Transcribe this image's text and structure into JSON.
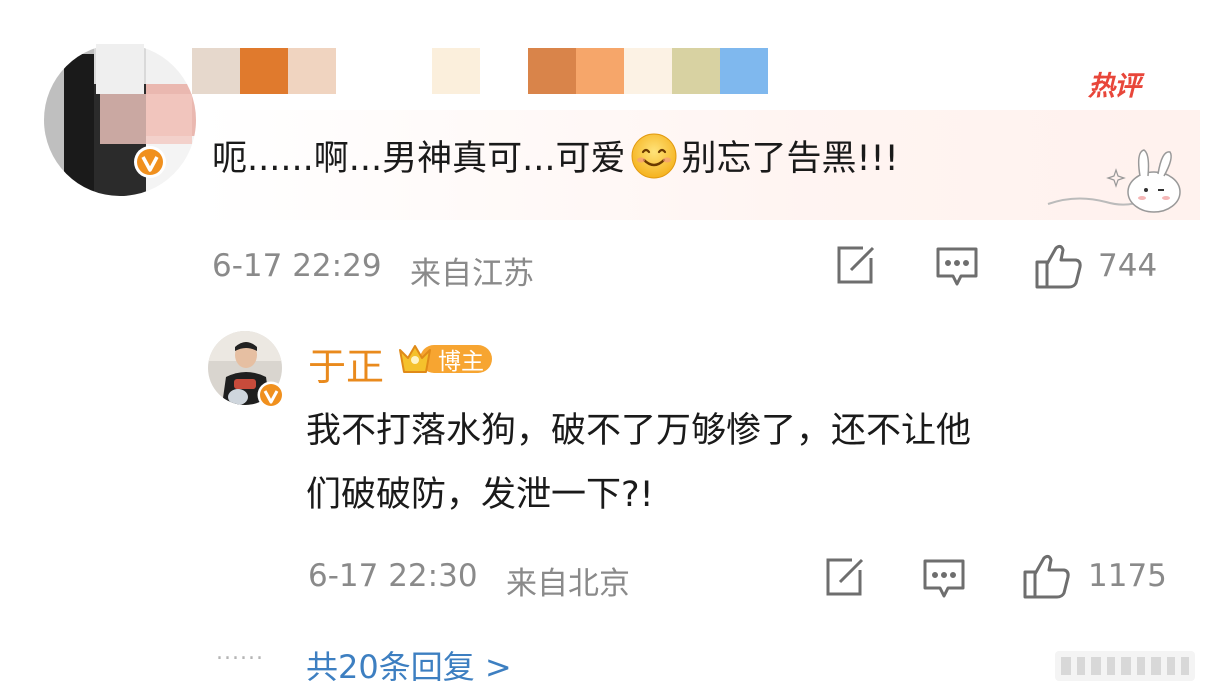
{
  "hot_label": "热评",
  "first_comment": {
    "text_before_emoji": "呃......啊...男神真可...可爱",
    "emoji": "smile-emoji",
    "text_after_emoji": "别忘了告黑!!!",
    "time": "6-17 22:29",
    "location": "来自江苏",
    "likes": "744"
  },
  "reply": {
    "author": "于正",
    "badge": "博主",
    "text_line1": "我不打落水狗，破不了万够惨了，还不让他",
    "text_line2": "们破破防，发泄一下?!",
    "time": "6-17 22:30",
    "location": "来自北京",
    "likes": "1175"
  },
  "more_replies": "共20条回复 >",
  "dots": "......",
  "colors": {
    "hot": "#e8463a",
    "author": "#e98a1d",
    "link": "#3d7fc1",
    "meta": "#8a8a8a"
  }
}
